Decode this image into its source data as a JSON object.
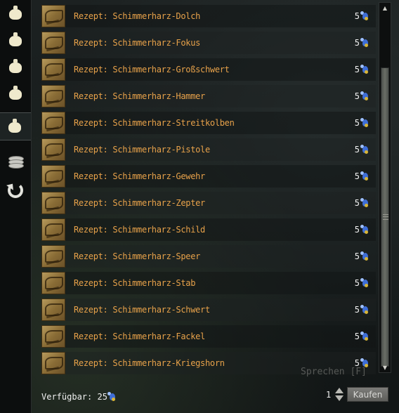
{
  "tabs": [
    {
      "icon": "bag-icon",
      "active": false
    },
    {
      "icon": "bag-icon",
      "active": false
    },
    {
      "icon": "bag-icon",
      "active": false
    },
    {
      "icon": "bag-icon",
      "active": false
    },
    {
      "icon": "bag-icon",
      "active": true
    },
    {
      "icon": "coins-icon",
      "active": false
    },
    {
      "icon": "undo-icon",
      "active": false
    }
  ],
  "items": [
    {
      "name": "Rezept: Schimmerharz-Dolch",
      "price": "5"
    },
    {
      "name": "Rezept: Schimmerharz-Fokus",
      "price": "5"
    },
    {
      "name": "Rezept: Schimmerharz-Großschwert",
      "price": "5"
    },
    {
      "name": "Rezept: Schimmerharz-Hammer",
      "price": "5"
    },
    {
      "name": "Rezept: Schimmerharz-Streitkolben",
      "price": "5"
    },
    {
      "name": "Rezept: Schimmerharz-Pistole",
      "price": "5"
    },
    {
      "name": "Rezept: Schimmerharz-Gewehr",
      "price": "5"
    },
    {
      "name": "Rezept: Schimmerharz-Zepter",
      "price": "5"
    },
    {
      "name": "Rezept: Schimmerharz-Schild",
      "price": "5"
    },
    {
      "name": "Rezept: Schimmerharz-Speer",
      "price": "5"
    },
    {
      "name": "Rezept: Schimmerharz-Stab",
      "price": "5"
    },
    {
      "name": "Rezept: Schimmerharz-Schwert",
      "price": "5"
    },
    {
      "name": "Rezept: Schimmerharz-Fackel",
      "price": "5"
    },
    {
      "name": "Rezept: Schimmerharz-Kriegshorn",
      "price": "5"
    }
  ],
  "currency_icon": "karma-icon",
  "speak_hint": "Sprechen [F]",
  "footer": {
    "available_label": "Verfügbar: 25",
    "quantity": "1",
    "buy_label": "Kaufen"
  },
  "colors": {
    "item_name": "#e8a24a",
    "accent_blue": "#3e6dd6"
  }
}
